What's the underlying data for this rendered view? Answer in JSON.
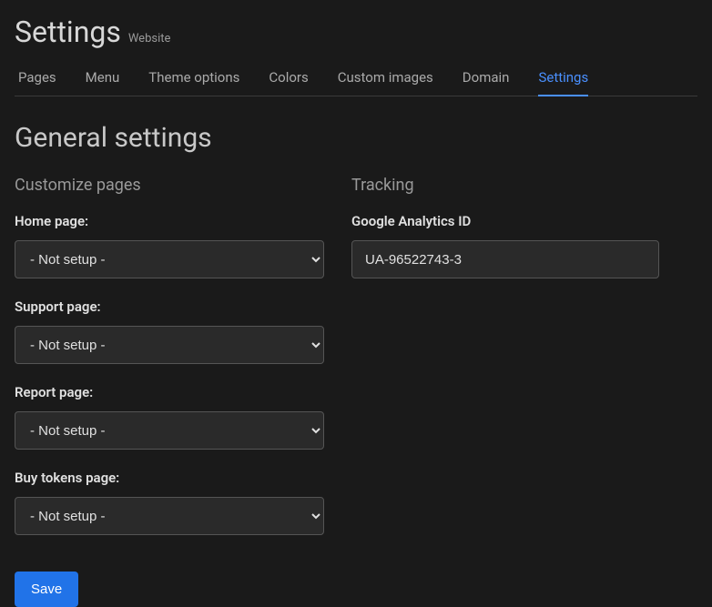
{
  "header": {
    "title": "Settings",
    "subtitle": "Website"
  },
  "tabs": {
    "pages": "Pages",
    "menu": "Menu",
    "theme_options": "Theme options",
    "colors": "Colors",
    "custom_images": "Custom images",
    "domain": "Domain",
    "settings": "Settings"
  },
  "section": {
    "title": "General settings"
  },
  "customize": {
    "title": "Customize pages",
    "home_label": "Home page:",
    "home_value": "- Not setup -",
    "support_label": "Support page:",
    "support_value": "- Not setup -",
    "report_label": "Report page:",
    "report_value": "- Not setup -",
    "buy_tokens_label": "Buy tokens page:",
    "buy_tokens_value": "- Not setup -"
  },
  "tracking": {
    "title": "Tracking",
    "ga_label": "Google Analytics ID",
    "ga_value": "UA-96522743-3"
  },
  "actions": {
    "save": "Save"
  }
}
